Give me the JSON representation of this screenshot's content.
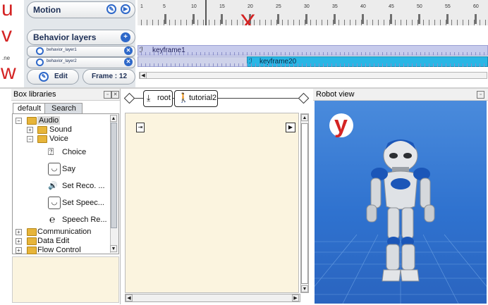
{
  "annotations": {
    "u": "u",
    "v": "v",
    "w": "w",
    "x": "X",
    "y": "y"
  },
  "edge_label": ".ne",
  "motion": {
    "label": "Motion"
  },
  "ruler": {
    "ticks": [
      "1",
      "5",
      "10",
      "15",
      "20",
      "25",
      "30",
      "35",
      "40",
      "45",
      "50",
      "55",
      "60"
    ]
  },
  "behavior_layers": {
    "title": "Behavior layers",
    "layers": [
      {
        "name": "behavior_layer1",
        "keyframe": "keyframe1"
      },
      {
        "name": "behavior_layer2",
        "keyframe": "keyframe20"
      }
    ]
  },
  "edit_button": {
    "label": "Edit"
  },
  "frame_indicator": {
    "label": "Frame : 12"
  },
  "box_libraries": {
    "title": "Box libraries",
    "tabs": [
      "default",
      "Search"
    ],
    "tree": [
      {
        "label": "Audio"
      },
      {
        "label": "Sound"
      },
      {
        "label": "Voice"
      },
      {
        "label": "Choice"
      },
      {
        "label": "Say"
      },
      {
        "label": "Set Reco. ..."
      },
      {
        "label": "Set Speec..."
      },
      {
        "label": "Speech Re..."
      },
      {
        "label": "Communication"
      },
      {
        "label": "Data Edit"
      },
      {
        "label": "Flow Control"
      }
    ]
  },
  "flow": {
    "breadcrumb": [
      "root",
      "tutorial2"
    ]
  },
  "robot_view": {
    "title": "Robot view"
  },
  "colors": {
    "accent": "#2e68c9",
    "annotation": "#d42323",
    "keyframe_fill": "#29b6e5"
  }
}
